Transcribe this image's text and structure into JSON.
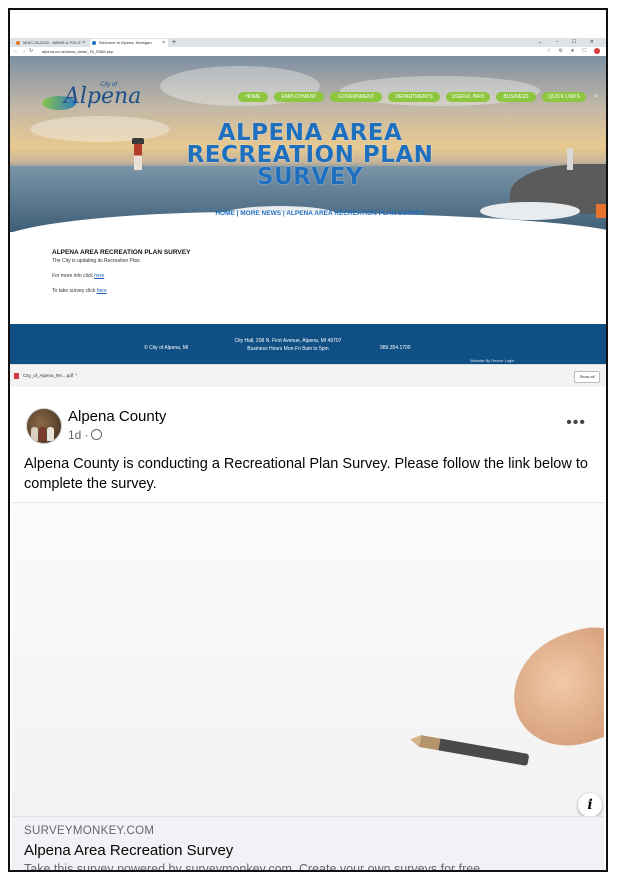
{
  "browser": {
    "tabs": [
      {
        "label": "MISC-05-2020 - NEWS & POLIT"
      },
      {
        "label": "Welcome to Alpena, Michigan"
      }
    ],
    "new_tab": "+",
    "url": "alpena.mi.us/news_detail_T6_R386.php",
    "window_controls": "⌄ – ☐ ✕"
  },
  "site": {
    "logo_text": "Alpena",
    "logo_city": "City of",
    "menu": [
      "HOME",
      "EMPLOYMENT",
      "GOVERNMENT",
      "DEPARTMENTS",
      "USEFUL INFO",
      "BUSINESS",
      "QUICK LINKS"
    ],
    "hero_title": "ALPENA AREA RECREATION PLAN SURVEY",
    "breadcrumb": "HOME | MORE NEWS | ALPENA AREA RECREATION PLAN SURVEY",
    "article_title": "ALPENA AREA RECREATION PLAN SURVEY",
    "article_lines": [
      {
        "text": "The City is updating its Recreation Plan.",
        "link": ""
      },
      {
        "text": "For more info click ",
        "link": "here"
      },
      {
        "text": "To take survey click ",
        "link": "here"
      }
    ],
    "footer": {
      "copyright": "© City of Alpena, MI",
      "address": "City Hall, 208 N. First Avenue, Alpena, MI 49707",
      "hours": "Business Hours Mon-Fri 8am to 5pm",
      "phone": "989.354.1700",
      "credit": "Website By Revize Login"
    },
    "download_chip": "City_of_Alpena_Re....pdf",
    "show_all": "Show all"
  },
  "post": {
    "author": "Alpena County",
    "meta": "1d ·",
    "more": "•••",
    "text": "Alpena County is conducting a Recreational Plan Survey. Please follow the link below to complete the survey.",
    "info_icon": "i",
    "link_domain": "SURVEYMONKEY.COM",
    "link_title": "Alpena Area Recreation Survey",
    "link_description": "Take this survey powered by surveymonkey.com. Create your own surveys for free."
  },
  "colors": {
    "menu_green": "#8dc63f",
    "site_blue": "#1f6fbf",
    "footer_navy": "#0f4f84"
  }
}
